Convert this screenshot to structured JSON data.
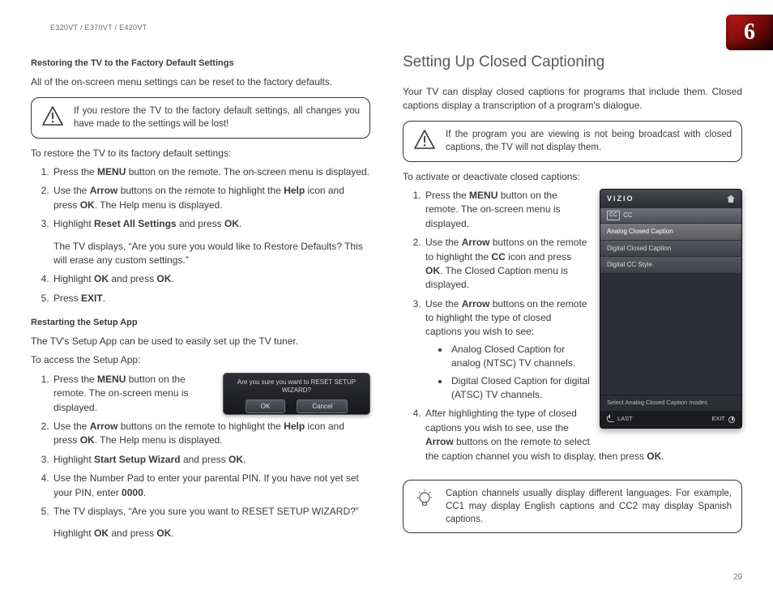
{
  "header": {
    "model_line": "E320VT / E370VT / E420VT",
    "chapter": "6",
    "page_number": "29"
  },
  "left": {
    "h_restore": "Restoring the TV to the Factory Default Settings",
    "p_restore_intro": "All of the on-screen menu settings can be reset to the factory defaults.",
    "warn_restore": "If you restore the TV to the factory default settings, all changes you have made to the settings will be lost!",
    "p_restore_lead": "To restore the TV to its factory default settings:",
    "ol_restore": {
      "i1a": "Press the ",
      "i1b": "MENU",
      "i1c": " button on the remote. The on-screen menu is displayed.",
      "i2a": "Use the ",
      "i2b": "Arrow",
      "i2c": " buttons on the remote to highlight the ",
      "i2d": "Help",
      "i2e": " icon and press ",
      "i2f": "OK",
      "i2g": ". The Help menu is displayed.",
      "i3a": "Highlight ",
      "i3b": "Reset All Settings",
      "i3c": " and press ",
      "i3d": "OK",
      "i3e": ".",
      "i3sub": "The TV displays, “Are you sure you would like to Restore Defaults? This will erase any custom settings.”",
      "i4a": "Highlight ",
      "i4b": "OK",
      "i4c": " and press ",
      "i4d": "OK",
      "i4e": ".",
      "i5a": "Press ",
      "i5b": "EXIT",
      "i5c": "."
    },
    "h_restart": "Restarting the Setup App",
    "p_restart_intro": "The TV's Setup App can be used to easily set up the TV tuner.",
    "p_restart_lead": "To access the Setup App:",
    "dialog": {
      "q1": "Are you sure you want to RESET SETUP",
      "q2": "WIZARD?",
      "ok": "OK",
      "cancel": "Cancel"
    },
    "ol_restart": {
      "i1a": "Press the ",
      "i1b": "MENU",
      "i1c": " button on the remote. The on-screen menu is displayed.",
      "i2a": "Use the ",
      "i2b": "Arrow",
      "i2c": " buttons on the remote to highlight the ",
      "i2d": "Help",
      "i2e": " icon and press ",
      "i2f": "OK",
      "i2g": ". The Help menu is displayed.",
      "i3a": "Highlight ",
      "i3b": "Start Setup Wizard",
      "i3c": " and press ",
      "i3d": "OK",
      "i3e": ".",
      "i4a": "Use the Number Pad to enter your parental PIN. If you have not yet set your PIN, enter ",
      "i4b": "0000",
      "i4c": ".",
      "i5": "The TV displays, “Are you sure you want to RESET SETUP WIZARD?”",
      "i5sub_a": "Highlight ",
      "i5sub_b": "OK",
      "i5sub_c": " and press ",
      "i5sub_d": "OK",
      "i5sub_e": "."
    }
  },
  "right": {
    "h_cc": "Setting Up Closed Captioning",
    "p_cc_intro": "Your TV can display closed captions for programs that include them. Closed captions display a transcription of a program's dialogue.",
    "warn_cc": "If the program you are viewing is not being broadcast with closed captions, the TV will not display them.",
    "p_cc_lead": "To activate or deactivate closed captions:",
    "tv": {
      "brand": "VIZIO",
      "crumb_cc": "CC",
      "row1": "Analog Closed Caption",
      "row2": "Digital Closed Caption",
      "row3": "Digital CC Style",
      "foot_msg": "Select Analog Closed Caption modes",
      "last": "LAST",
      "exit": "EXIT"
    },
    "ol_cc": {
      "i1a": "Press the ",
      "i1b": "MENU",
      "i1c": " button on the remote. The on-screen menu is displayed.",
      "i2a": "Use the ",
      "i2b": "Arrow",
      "i2c": " buttons on the remote to highlight the ",
      "i2d": "CC",
      "i2e": " icon and press ",
      "i2f": "OK",
      "i2g": ". The Closed Caption menu is displayed.",
      "i3a": "Use the ",
      "i3b": "Arrow",
      "i3c": " buttons on the remote to highlight the type of closed captions you wish to see:",
      "b1": "Analog Closed Caption for analog (NTSC) TV channels.",
      "b2": "Digital Closed Caption for digital (ATSC) TV channels.",
      "i4a": "After highlighting the type of closed captions you wish to see, use the ",
      "i4b": "Arrow",
      "i4c": " buttons on the remote to select the caption channel you wish to display, then press ",
      "i4d": "OK",
      "i4e": "."
    },
    "tip_cc": "Caption channels usually display different languages. For example, CC1 may display English captions and CC2 may display Spanish captions."
  }
}
